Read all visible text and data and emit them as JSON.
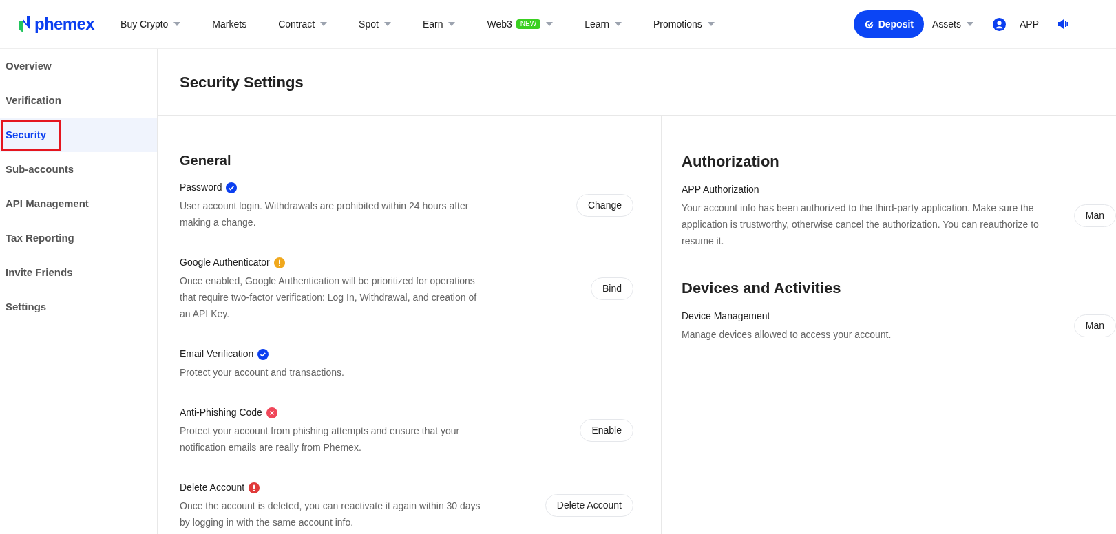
{
  "header": {
    "logo": "phemex",
    "nav": [
      {
        "label": "Buy Crypto",
        "dropdown": true
      },
      {
        "label": "Markets",
        "dropdown": false
      },
      {
        "label": "Contract",
        "dropdown": true
      },
      {
        "label": "Spot",
        "dropdown": true
      },
      {
        "label": "Earn",
        "dropdown": true
      },
      {
        "label": "Web3",
        "dropdown": true,
        "badge": "NEW"
      },
      {
        "label": "Learn",
        "dropdown": true
      },
      {
        "label": "Promotions",
        "dropdown": true
      }
    ],
    "deposit": "Deposit",
    "assets": "Assets",
    "app": "APP"
  },
  "sidebar": {
    "items": [
      {
        "label": "Overview",
        "selected": false,
        "highlighted": false
      },
      {
        "label": "Verification",
        "selected": false,
        "highlighted": false
      },
      {
        "label": "Security",
        "selected": true,
        "highlighted": true
      },
      {
        "label": "Sub-accounts",
        "selected": false,
        "highlighted": false
      },
      {
        "label": "API Management",
        "selected": false,
        "highlighted": false
      },
      {
        "label": "Tax Reporting",
        "selected": false,
        "highlighted": false
      },
      {
        "label": "Invite Friends",
        "selected": false,
        "highlighted": false
      },
      {
        "label": "Settings",
        "selected": false,
        "highlighted": false
      }
    ]
  },
  "page_title": "Security Settings",
  "general": {
    "heading": "General",
    "items": [
      {
        "title": "Password",
        "kind": "verified",
        "description": "User account login. Withdrawals are prohibited within 24 hours after making a change.",
        "button": "Change"
      },
      {
        "title": "Google Authenticator",
        "kind": "warning",
        "description": "Once enabled, Google Authentication will be prioritized for operations that require two-factor verification: Log In, Withdrawal, and creation of an API Key.",
        "button": "Bind"
      },
      {
        "title": "Email Verification",
        "kind": "verified",
        "description": "Protect your account and transactions."
      },
      {
        "title": "Anti-Phishing Code",
        "kind": "off",
        "description": "Protect your account from phishing attempts and ensure that your notification emails are really from Phemex.",
        "button": "Enable"
      },
      {
        "title": "Delete Account",
        "kind": "danger",
        "description": "Once the account is deleted, you can reactivate it again within 30 days by logging in with the same account info.",
        "button": "Delete Account"
      }
    ]
  },
  "sections": [
    {
      "heading": "Authorization",
      "items": [
        {
          "title": "APP Authorization",
          "description": "Your account info has been authorized to the third-party application. Make sure the application is trustworthy, otherwise cancel the authorization. You can reauthorize to resume it.",
          "button": "Man"
        }
      ]
    },
    {
      "heading": "Devices and Activities",
      "items": [
        {
          "title": "Device Management",
          "description": "Manage devices allowed to access your account.",
          "button": "Man"
        }
      ]
    }
  ]
}
